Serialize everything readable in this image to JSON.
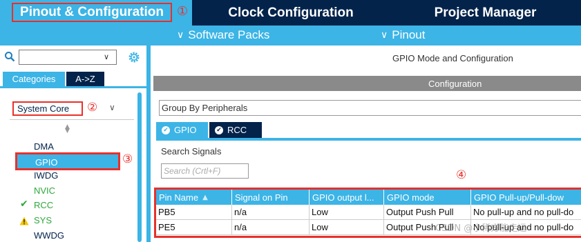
{
  "top_tabs": [
    {
      "label": "Pinout & Configuration",
      "active": true
    },
    {
      "label": "Clock Configuration",
      "active": false
    },
    {
      "label": "Project Manager",
      "active": false
    }
  ],
  "sub_menu": [
    {
      "label": "Software Packs"
    },
    {
      "label": "Pinout"
    }
  ],
  "annotations": [
    "①",
    "②",
    "③",
    "④"
  ],
  "left_panel": {
    "search_value": "",
    "category_tabs": [
      "Categories",
      "A->Z"
    ],
    "category": "System Core",
    "peripherals": [
      {
        "label": "DMA",
        "status": "none"
      },
      {
        "label": "GPIO",
        "status": "selected"
      },
      {
        "label": "IWDG",
        "status": "none"
      },
      {
        "label": "NVIC",
        "status": "enabled"
      },
      {
        "label": "RCC",
        "status": "configured"
      },
      {
        "label": "SYS",
        "status": "warning"
      },
      {
        "label": "WWDG",
        "status": "none"
      }
    ]
  },
  "right_panel": {
    "title": "GPIO Mode and Configuration",
    "configuration_label": "Configuration",
    "group_by": "Group By Peripherals",
    "tabs": [
      {
        "label": "GPIO",
        "active": true
      },
      {
        "label": "RCC",
        "active": false
      }
    ],
    "search_signals_label": "Search Signals",
    "search_signals_placeholder": "Search (Crtl+F)",
    "table": {
      "headers": [
        "Pin Name",
        "Signal on Pin",
        "GPIO output l...",
        "GPIO mode",
        "GPIO Pull-up/Pull-dow"
      ],
      "rows": [
        [
          "PB5",
          "n/a",
          "Low",
          "Output Push Pull",
          "No pull-up and no pull-do"
        ],
        [
          "PE5",
          "n/a",
          "Low",
          "Output Push Pull",
          "No pull-up and no pull-do"
        ]
      ]
    }
  },
  "watermark": "CSDN @小稀方能走远",
  "colors": {
    "accent": "#3cb4e6",
    "dark_navy": "#03234b",
    "annotation_red": "#e8302a",
    "enabled_green": "#2fa83a",
    "warning_yellow": "#f5c400"
  }
}
